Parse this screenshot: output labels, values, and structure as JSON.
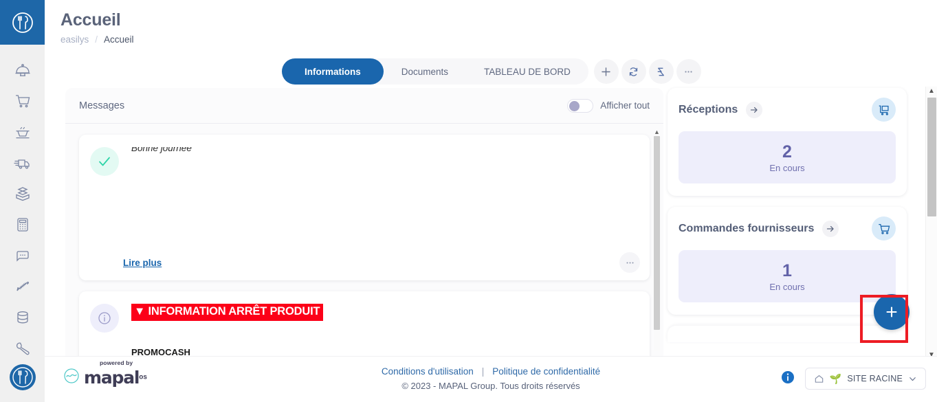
{
  "app": {
    "logo_icon": "fork-spoon-circle-logo"
  },
  "sidebar": {
    "items": [
      {
        "icon": "cloche-dome-icon",
        "name": "sidebar-item-cloche"
      },
      {
        "icon": "shopping-cart-icon",
        "name": "sidebar-item-cart"
      },
      {
        "icon": "cooking-pot-icon",
        "name": "sidebar-item-pot"
      },
      {
        "icon": "delivery-truck-icon",
        "name": "sidebar-item-truck"
      },
      {
        "icon": "stacked-box-icon",
        "name": "sidebar-item-stock"
      },
      {
        "icon": "calculator-icon",
        "name": "sidebar-item-calculator"
      },
      {
        "icon": "chat-bubble-icon",
        "name": "sidebar-item-chat"
      },
      {
        "icon": "fish-bone-icon",
        "name": "sidebar-item-fish"
      },
      {
        "icon": "database-icon",
        "name": "sidebar-item-database"
      },
      {
        "icon": "wrench-icon",
        "name": "sidebar-item-settings"
      }
    ],
    "bottom_logo_icon": "fork-spoon-circle-logo"
  },
  "header": {
    "title": "Accueil",
    "breadcrumb": {
      "root": "easilys",
      "separator": "/",
      "current": "Accueil"
    }
  },
  "tabs": {
    "items": [
      {
        "label": "Informations",
        "active": true
      },
      {
        "label": "Documents",
        "active": false
      },
      {
        "label": "TABLEAU DE BORD",
        "active": false
      }
    ],
    "actions": [
      {
        "icon": "plus-icon",
        "name": "add-tab-button"
      },
      {
        "icon": "refresh-icon",
        "name": "refresh-button"
      },
      {
        "icon": "transfer-icon",
        "name": "transfer-button"
      },
      {
        "icon": "ellipsis-icon",
        "name": "more-options-button"
      }
    ]
  },
  "messages": {
    "title": "Messages",
    "toggle_label": "Afficher tout",
    "toggle_state": "off",
    "items": [
      {
        "avatar_icon": "check-icon",
        "avatar_style": "green",
        "text": "Bonne journee",
        "link_label": "Lire plus",
        "more_icon": "ellipsis-icon"
      },
      {
        "avatar_icon": "info-icon",
        "avatar_style": "purple",
        "banner": "▼ INFORMATION ARRÊT PRODUIT",
        "body": "PROMOCASH"
      }
    ]
  },
  "stat_cards": [
    {
      "title": "Réceptions",
      "arrow_icon": "arrow-right-icon",
      "card_icon": "reception-cart-icon",
      "value": "2",
      "value_label": "En cours"
    },
    {
      "title": "Commandes fournisseurs",
      "arrow_icon": "arrow-right-icon",
      "card_icon": "shopping-cart-icon",
      "value": "1",
      "value_label": "En cours",
      "fab_icon": "plus-icon",
      "fab_highlighted": true
    }
  ],
  "footer": {
    "logo": {
      "powered_by": "powered by",
      "word": "mapal",
      "suffix": "os",
      "icon": "mapal-wave-icon"
    },
    "links": [
      {
        "label": "Conditions d'utilisation"
      },
      {
        "label": "Politique de confidentialité"
      }
    ],
    "separator": "|",
    "copyright": "© 2023 - MAPAL Group. Tous droits réservés",
    "info_icon": "info-circle-icon",
    "site_selector": {
      "home_icon": "home-icon",
      "tree_icon": "🌱",
      "label": "SITE RACINE",
      "chevron_icon": "chevron-down-icon"
    }
  },
  "colors": {
    "brand_blue": "#1a66ad",
    "accent_red": "#fc0018",
    "highlight_red": "#ed1c24",
    "stat_purple": "#6262a8",
    "stat_bg": "#eeeefb"
  }
}
